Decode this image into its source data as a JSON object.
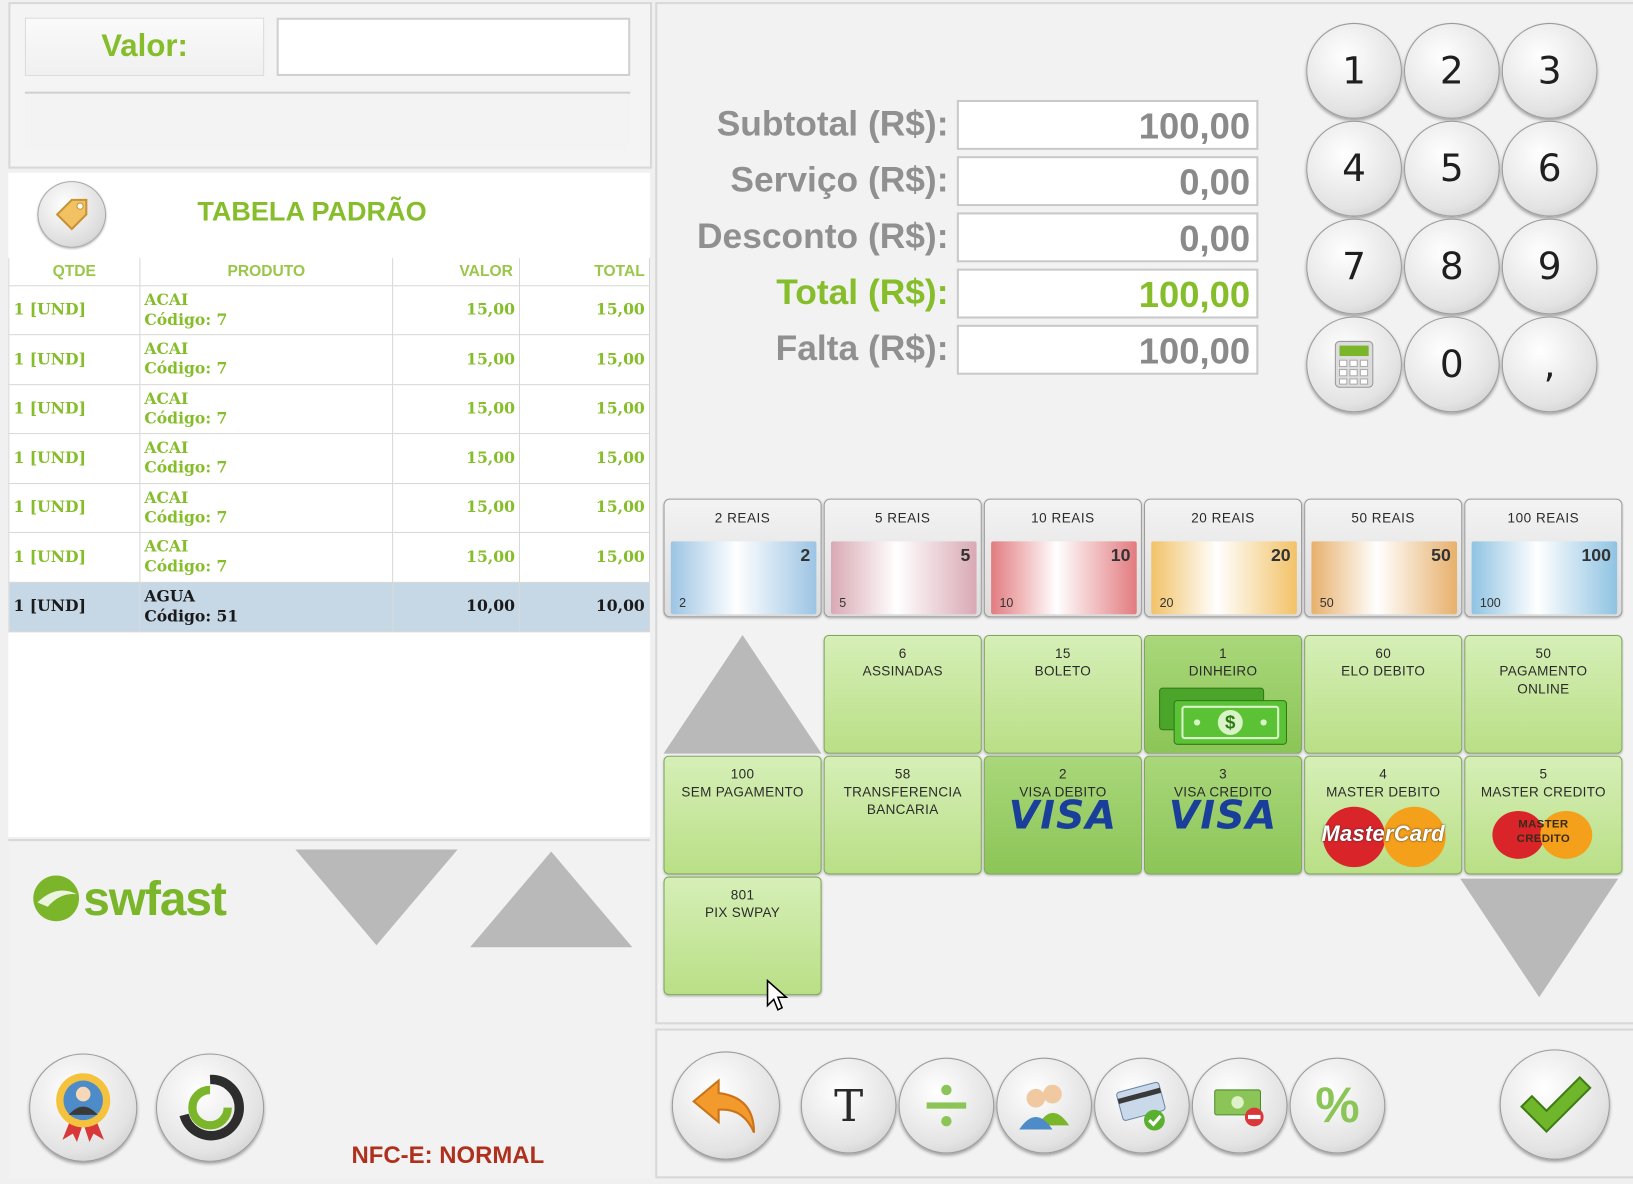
{
  "header": {
    "valor_label": "Valor:",
    "valor_value": ""
  },
  "table": {
    "title": "TABELA PADRÃO",
    "columns": [
      "QTDE",
      "PRODUTO",
      "VALOR",
      "TOTAL"
    ],
    "rows": [
      {
        "qtde": "1 [UND]",
        "produto": "ACAI",
        "codigo": "Código: 7",
        "valor": "15,00",
        "total": "15,00"
      },
      {
        "qtde": "1 [UND]",
        "produto": "ACAI",
        "codigo": "Código: 7",
        "valor": "15,00",
        "total": "15,00"
      },
      {
        "qtde": "1 [UND]",
        "produto": "ACAI",
        "codigo": "Código: 7",
        "valor": "15,00",
        "total": "15,00"
      },
      {
        "qtde": "1 [UND]",
        "produto": "ACAI",
        "codigo": "Código: 7",
        "valor": "15,00",
        "total": "15,00"
      },
      {
        "qtde": "1 [UND]",
        "produto": "ACAI",
        "codigo": "Código: 7",
        "valor": "15,00",
        "total": "15,00"
      },
      {
        "qtde": "1 [UND]",
        "produto": "ACAI",
        "codigo": "Código: 7",
        "valor": "15,00",
        "total": "15,00"
      },
      {
        "qtde": "1 [UND]",
        "produto": "AGUA",
        "codigo": "Código: 51",
        "valor": "10,00",
        "total": "10,00",
        "selected": true
      }
    ]
  },
  "logo": {
    "text": "swfast"
  },
  "status": {
    "nfce": "NFC-E: NORMAL"
  },
  "summary": {
    "subtotal_label": "Subtotal (R$):",
    "subtotal": "100,00",
    "servico_label": "Serviço (R$):",
    "servico": "0,00",
    "desconto_label": "Desconto (R$):",
    "desconto": "0,00",
    "total_label": "Total (R$):",
    "total": "100,00",
    "falta_label": "Falta (R$):",
    "falta": "100,00"
  },
  "keypad": [
    "1",
    "2",
    "3",
    "4",
    "5",
    "6",
    "7",
    "8",
    "9",
    "calculator-icon",
    "0",
    ","
  ],
  "notes": [
    {
      "label": "2 REAIS",
      "num": "2",
      "color": "#9cc4e4"
    },
    {
      "label": "5 REAIS",
      "num": "5",
      "color": "#d9a9b4"
    },
    {
      "label": "10 REAIS",
      "num": "10",
      "color": "#e27b7f"
    },
    {
      "label": "20 REAIS",
      "num": "20",
      "color": "#f2c267"
    },
    {
      "label": "50 REAIS",
      "num": "50",
      "color": "#e7b06c"
    },
    {
      "label": "100 REAIS",
      "num": "100",
      "color": "#8fc3e2"
    }
  ],
  "payments": [
    {
      "code": "6",
      "name": "ASSINADAS"
    },
    {
      "code": "15",
      "name": "BOLETO"
    },
    {
      "code": "1",
      "name": "DINHEIRO"
    },
    {
      "code": "60",
      "name": "ELO DEBITO"
    },
    {
      "code": "50",
      "name": "PAGAMENTO",
      "name2": "ONLINE"
    },
    {
      "code": "100",
      "name": "SEM PAGAMENTO"
    },
    {
      "code": "58",
      "name": "TRANSFERENCIA",
      "name2": "BANCARIA"
    },
    {
      "code": "2",
      "name": "VISA DEBITO",
      "logo": "VISA"
    },
    {
      "code": "3",
      "name": "VISA CREDITO",
      "logo": "VISA"
    },
    {
      "code": "4",
      "name": "MASTER DEBITO",
      "logo": "MasterCard"
    },
    {
      "code": "5",
      "name": "MASTER CREDITO",
      "logo": "MASTER CREDITO"
    },
    {
      "code": "801",
      "name": "PIX SWPAY"
    }
  ],
  "toolbar": {
    "text_tool": "T",
    "percent_tool": "%"
  },
  "colors": {
    "accent": "#86bd2a",
    "pay_green": "#b9df86",
    "selected_row": "#c6d7e6",
    "status_red": "#b0301e"
  }
}
